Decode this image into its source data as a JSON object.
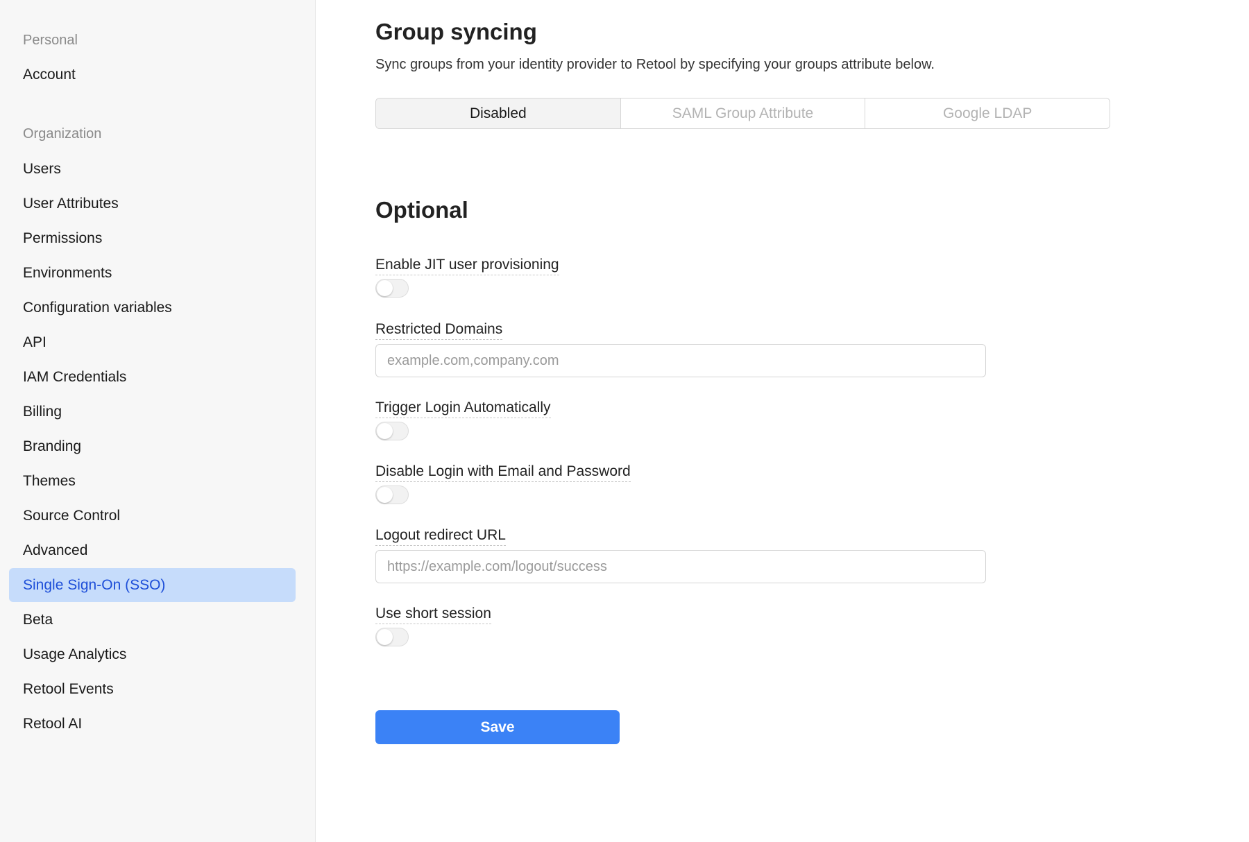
{
  "sidebar": {
    "personal_label": "Personal",
    "personal_items": [
      {
        "label": "Account"
      }
    ],
    "organization_label": "Organization",
    "organization_items": [
      {
        "label": "Users"
      },
      {
        "label": "User Attributes"
      },
      {
        "label": "Permissions"
      },
      {
        "label": "Environments"
      },
      {
        "label": "Configuration variables"
      },
      {
        "label": "API"
      },
      {
        "label": "IAM Credentials"
      },
      {
        "label": "Billing"
      },
      {
        "label": "Branding"
      },
      {
        "label": "Themes"
      },
      {
        "label": "Source Control"
      },
      {
        "label": "Advanced"
      },
      {
        "label": "Single Sign-On (SSO)",
        "active": true
      },
      {
        "label": "Beta"
      },
      {
        "label": "Usage Analytics"
      },
      {
        "label": "Retool Events"
      },
      {
        "label": "Retool AI"
      }
    ]
  },
  "group_syncing": {
    "title": "Group syncing",
    "description": "Sync groups from your identity provider to Retool by specifying your groups attribute below.",
    "options": [
      {
        "label": "Disabled",
        "selected": true
      },
      {
        "label": "SAML Group Attribute",
        "selected": false
      },
      {
        "label": "Google LDAP",
        "selected": false
      }
    ]
  },
  "optional": {
    "title": "Optional",
    "jit_label": "Enable JIT user provisioning",
    "jit_enabled": false,
    "restricted_domains_label": "Restricted Domains",
    "restricted_domains_placeholder": "example.com,company.com",
    "restricted_domains_value": "",
    "trigger_login_label": "Trigger Login Automatically",
    "trigger_login_enabled": false,
    "disable_login_label": "Disable Login with Email and Password",
    "disable_login_enabled": false,
    "logout_redirect_label": "Logout redirect URL",
    "logout_redirect_placeholder": "https://example.com/logout/success",
    "logout_redirect_value": "",
    "short_session_label": "Use short session",
    "short_session_enabled": false
  },
  "actions": {
    "save_label": "Save"
  },
  "colors": {
    "accent": "#3b82f6",
    "active_item_bg": "#c6dcfb",
    "active_item_text": "#1d4ed8"
  }
}
